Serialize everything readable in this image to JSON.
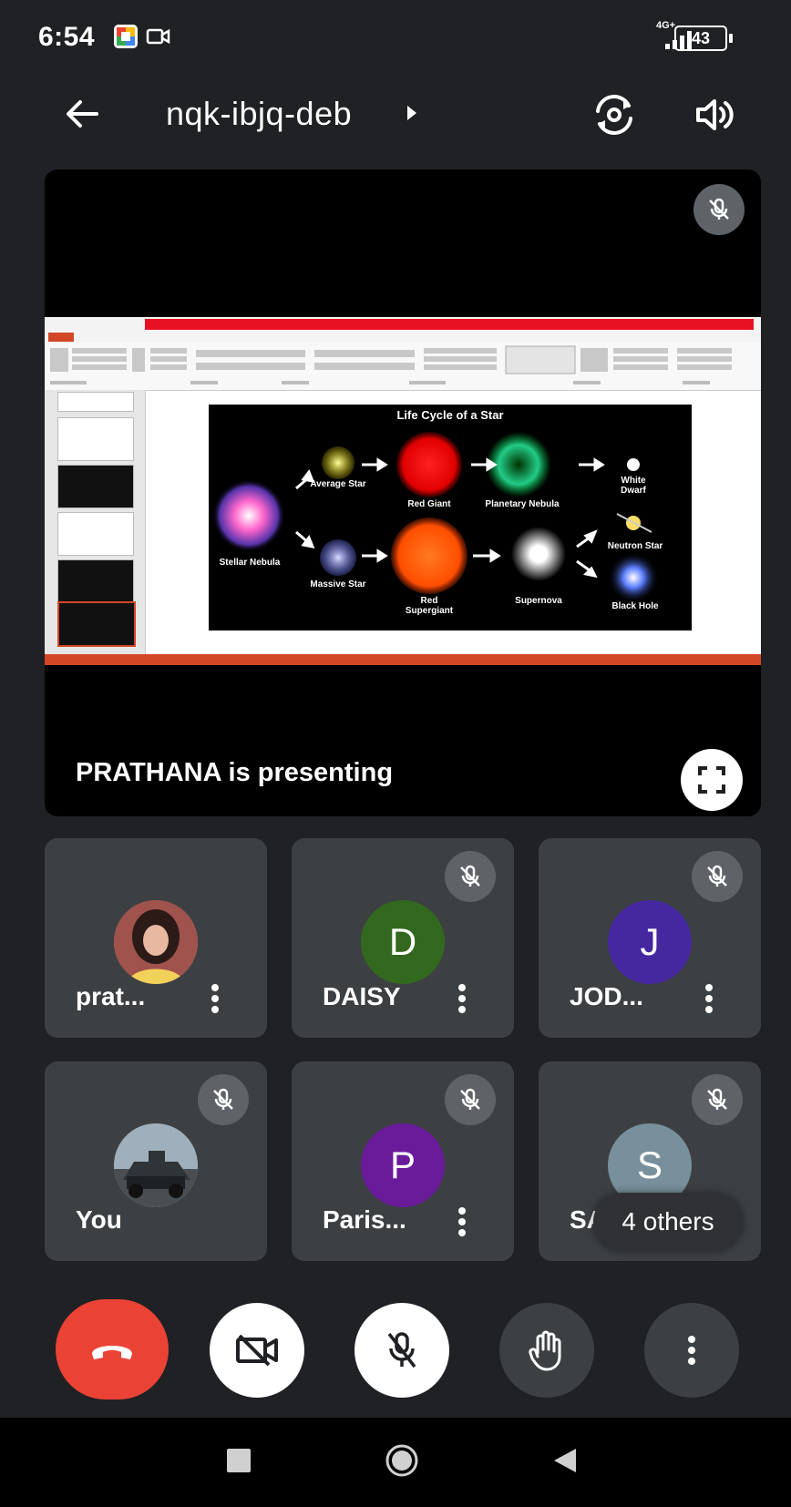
{
  "status_bar": {
    "time": "6:54",
    "network": "4G+",
    "battery": "43"
  },
  "header": {
    "meeting_code": "nqk-ibjq-deb"
  },
  "presentation": {
    "label": "PRATHANA is presenting",
    "slide": {
      "title": "Life Cycle of a Star",
      "labels": {
        "average_star": "Average Star",
        "red_giant": "Red Giant",
        "planetary_nebula": "Planetary Nebula",
        "white_dwarf": "White Dwarf",
        "stellar_nebula": "Stellar Nebula",
        "massive_star": "Massive Star",
        "red_supergiant": "Red Supergiant",
        "supernova": "Supernova",
        "neutron_star": "Neutron Star",
        "black_hole": "Black Hole"
      }
    }
  },
  "participants": [
    {
      "name": "prat...",
      "initial": "",
      "color": "#7a2a2a",
      "muted": false,
      "photo": true
    },
    {
      "name": "DAISY",
      "initial": "D",
      "color": "#33691e",
      "muted": true,
      "photo": false
    },
    {
      "name": "JOD...",
      "initial": "J",
      "color": "#4527a0",
      "muted": true,
      "photo": false
    },
    {
      "name": "You",
      "initial": "",
      "color": "#4a5560",
      "muted": true,
      "photo": true
    },
    {
      "name": "Paris...",
      "initial": "P",
      "color": "#6a1b9a",
      "muted": true,
      "photo": false
    },
    {
      "name": "SATYE...",
      "initial": "S",
      "color": "#78909c",
      "muted": true,
      "photo": false,
      "overflow_label": "4 others"
    }
  ],
  "controls": {
    "end_call_color": "#ea4335",
    "icons": [
      "end-call-icon",
      "camera-off-icon",
      "mic-off-icon",
      "raise-hand-icon",
      "more-vert-icon"
    ]
  }
}
